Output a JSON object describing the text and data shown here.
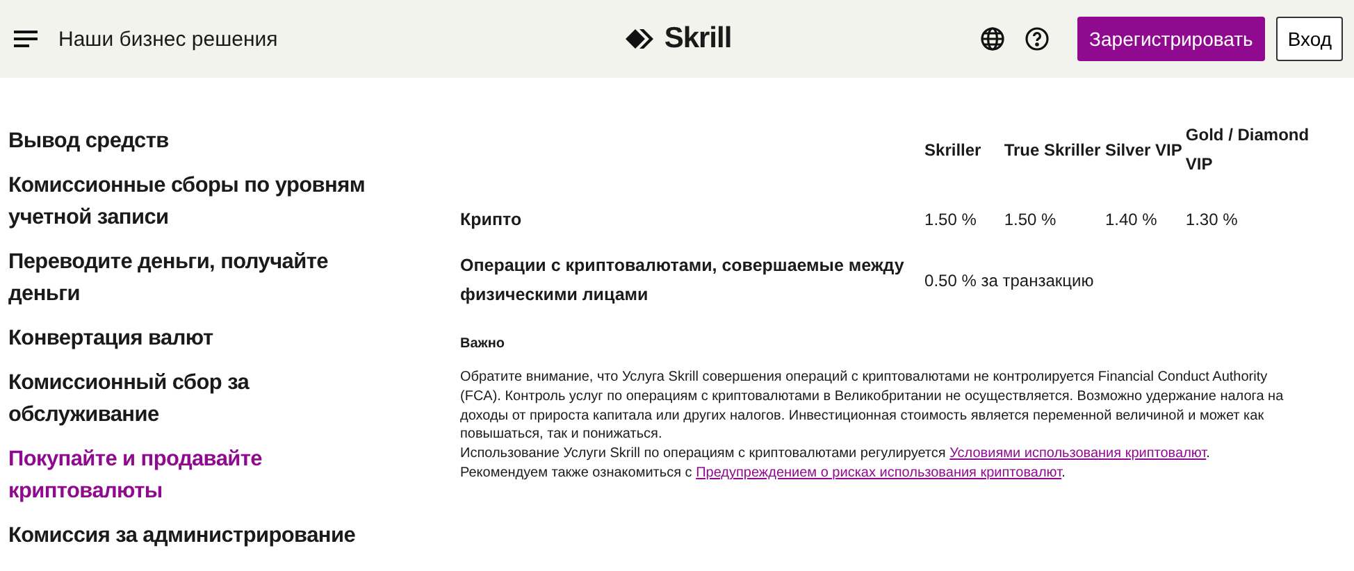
{
  "header": {
    "menu_label": "Наши бизнес решения",
    "logo": "Skrill",
    "register": "Зарегистрировать",
    "login": "Вход"
  },
  "sidebar": {
    "items": [
      {
        "label": "Вывод средств",
        "selected": false
      },
      {
        "label": "Комиссионные сборы по уровням учетной записи",
        "selected": false
      },
      {
        "label": "Переводите деньги, получайте деньги",
        "selected": false
      },
      {
        "label": "Конвертация валют",
        "selected": false
      },
      {
        "label": "Комиссионный сбор за обслуживание",
        "selected": false
      },
      {
        "label": "Покупайте и продавайте криптовалюты",
        "selected": true
      },
      {
        "label": "Комиссия за администрирование",
        "selected": false
      }
    ]
  },
  "table": {
    "columns": [
      "Skriller",
      "True Skriller",
      "Silver VIP",
      "Gold / Diamond VIP"
    ],
    "rows": [
      {
        "label": "Крипто",
        "cells": [
          "1.50 %",
          "1.50 %",
          "1.40 %",
          "1.30 %"
        ]
      },
      {
        "label": "Операции с криптовалютами, совершаемые между физическими лицами",
        "span": "0.50 % за транзакцию"
      }
    ]
  },
  "notice": {
    "title": "Важно",
    "paragraphs": [
      {
        "text": "Обратите внимание, что Услуга Skrill совершения операций с криптовалютами не контролируется Financial Conduct Authority (FCA). Контроль услуг по операциям с криптовалютами в Великобритании не осуществляется. Возможно удержание налога на доходы от прироста капитала или других налогов. Инвестиционная стоимость является переменной величиной и может как повышаться, так и понижаться."
      },
      {
        "text": "Использование Услуги Skrill по операциям с криптовалютами регулируется",
        "link": "Условиями использования криптовалют",
        "after": "."
      },
      {
        "text": "Рекомендуем также ознакомиться с",
        "link": "Предупреждением о рисках использования криптовалют",
        "after": "."
      }
    ]
  }
}
